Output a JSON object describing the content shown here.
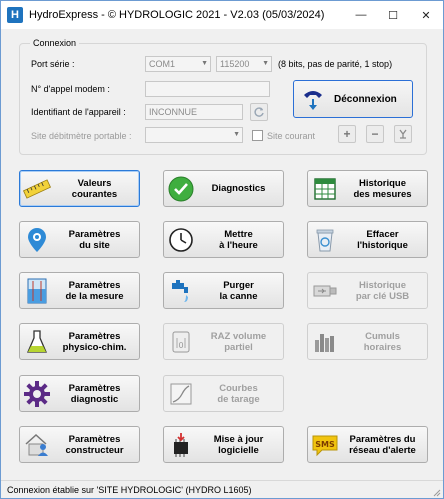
{
  "window": {
    "title": "HydroExpress - © HYDROLOGIC 2021 - V2.03 (05/03/2024)",
    "minimize": "—",
    "maximize": "☐",
    "close": "✕"
  },
  "connexion": {
    "group_title": "Connexion",
    "port_label": "Port série :",
    "port_value": "COM1",
    "baud_value": "115200",
    "port_info": "(8 bits, pas de parité, 1 stop)",
    "modem_label": "N° d'appel modem :",
    "modem_value": "",
    "device_label": "Identifiant de l'appareil :",
    "device_value": "INCONNUE",
    "flowmeter_label": "Site débitmètre portable :",
    "flowmeter_value": "",
    "current_site_label": "Site courant",
    "disconnect_label": "Déconnexion"
  },
  "buttons": {
    "valeurs": "Valeurs\ncourantes",
    "diagnostics": "Diagnostics",
    "historique": "Historique\ndes mesures",
    "param_site": "Paramètres\ndu site",
    "mettre_heure": "Mettre\nà l'heure",
    "effacer": "Effacer\nl'historique",
    "param_mesure": "Paramètres\nde la mesure",
    "purger": "Purger\nla canne",
    "hist_usb": "Historique\npar clé USB",
    "param_physico": "Paramètres\nphysico-chim.",
    "raz_volume": "RAZ volume\npartiel",
    "cumuls": "Cumuls\nhoraires",
    "param_diag": "Paramètres\ndiagnostic",
    "courbes": "Courbes\nde tarage",
    "param_constructeur": "Paramètres\nconstructeur",
    "mise_a_jour": "Mise à jour\nlogicielle",
    "param_alerte": "Paramètres du\nréseau d'alerte",
    "sms_text": "SMS"
  },
  "status": {
    "text": "Connexion établie sur 'SITE HYDROLOGIC' (HYDRO L1605)"
  },
  "colors": {
    "accent": "#2b7ad8",
    "check_green": "#3fae3f",
    "purple": "#5b2a86",
    "title_icon": "#1e73be"
  }
}
